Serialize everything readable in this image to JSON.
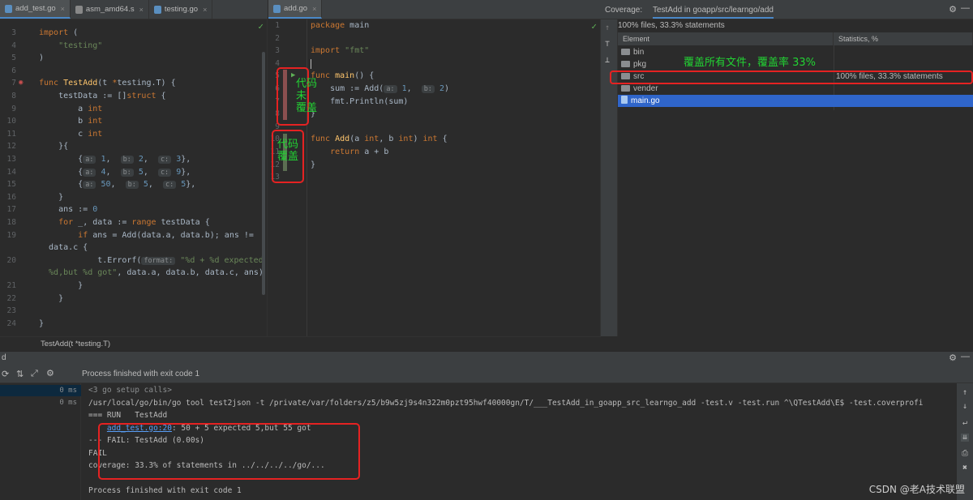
{
  "left_tabs": [
    {
      "label": "add_test.go",
      "active": true
    },
    {
      "label": "asm_amd64.s",
      "active": false
    },
    {
      "label": "testing.go",
      "active": false
    }
  ],
  "right_tabs": [
    {
      "label": "add.go",
      "active": true
    }
  ],
  "left_editor": {
    "lines": [
      {
        "n": "3",
        "html": "<span class='kw'>import</span> ("
      },
      {
        "n": "4",
        "html": "    <span class='str'>\"testing\"</span>"
      },
      {
        "n": "5",
        "html": ")"
      },
      {
        "n": "6",
        "html": ""
      },
      {
        "n": "7",
        "html": "<span class='kw'>func</span> <span class='fn'>TestAdd</span>(t <span class='kw'>*</span>testing.T) {"
      },
      {
        "n": "8",
        "html": "    testData := []<span class='kw'>struct</span> {"
      },
      {
        "n": "9",
        "html": "        a <span class='ty'>int</span>"
      },
      {
        "n": "10",
        "html": "        b <span class='ty'>int</span>"
      },
      {
        "n": "11",
        "html": "        c <span class='ty'>int</span>"
      },
      {
        "n": "12",
        "html": "    }{"
      },
      {
        "n": "13",
        "html": "        {<span class='hint'>a:</span> <span class='num'>1</span>,  <span class='hint'>b:</span> <span class='num'>2</span>,  <span class='hint'>c:</span> <span class='num'>3</span>},"
      },
      {
        "n": "14",
        "html": "        {<span class='hint'>a:</span> <span class='num'>4</span>,  <span class='hint'>b:</span> <span class='num'>5</span>,  <span class='hint'>c:</span> <span class='num'>9</span>},"
      },
      {
        "n": "15",
        "html": "        {<span class='hint'>a:</span> <span class='num'>50</span>,  <span class='hint'>b:</span> <span class='num'>5</span>,  <span class='hint'>c:</span> <span class='num'>5</span>},"
      },
      {
        "n": "16",
        "html": "    }"
      },
      {
        "n": "17",
        "html": "    ans := <span class='num'>0</span>"
      },
      {
        "n": "18",
        "html": "    <span class='kw'>for</span> _, data := <span class='kw'>range</span> testData {"
      },
      {
        "n": "19",
        "html": "        <span class='kw'>if</span> ans = Add(data.a, data.b); ans !="
      },
      {
        "n": "",
        "html": "  data.c {"
      },
      {
        "n": "20",
        "html": "            t.Errorf(<span class='hint'>format:</span> <span class='str'>\"%d + %d expected</span>"
      },
      {
        "n": "",
        "html": "<span class='str'>  %d,but %d got\"</span>, data.a, data.b, data.c, ans)"
      },
      {
        "n": "21",
        "html": "        }"
      },
      {
        "n": "22",
        "html": "    }"
      },
      {
        "n": "23",
        "html": ""
      },
      {
        "n": "24",
        "html": "}"
      }
    ]
  },
  "right_editor": {
    "lines": [
      {
        "n": "1",
        "html": "<span class='kw'>package</span> main"
      },
      {
        "n": "2",
        "html": ""
      },
      {
        "n": "3",
        "html": "<span class='kw'>import</span> <span class='str'>\"fmt\"</span>"
      },
      {
        "n": "4",
        "html": ""
      },
      {
        "n": "5",
        "html": "<span class='kw'>func</span> <span class='fn'>main</span>() {"
      },
      {
        "n": "6",
        "html": "    sum := Add(<span class='hint'>a:</span> <span class='num'>1</span>,  <span class='hint'>b:</span> <span class='num'>2</span>)"
      },
      {
        "n": "7",
        "html": "    fmt.Println(sum)"
      },
      {
        "n": "8",
        "html": "}"
      },
      {
        "n": "9",
        "html": ""
      },
      {
        "n": "10",
        "html": "<span class='kw'>func</span> <span class='fn'>Add</span>(a <span class='ty'>int</span>, b <span class='ty'>int</span>) <span class='ty'>int</span> {"
      },
      {
        "n": "11",
        "html": "    <span class='kw'>return</span> a + b"
      },
      {
        "n": "12",
        "html": "}"
      },
      {
        "n": "13",
        "html": ""
      }
    ]
  },
  "coverage": {
    "label": "Coverage:",
    "tab": "TestAdd in goapp/src/learngo/add",
    "summary": "100% files, 33.3% statements",
    "col_element": "Element",
    "col_stats": "Statistics, %",
    "rows": [
      {
        "name": "bin",
        "kind": "folder",
        "stats": ""
      },
      {
        "name": "pkg",
        "kind": "folder",
        "stats": ""
      },
      {
        "name": "src",
        "kind": "folder",
        "stats": "100% files, 33.3% statements"
      },
      {
        "name": "vender",
        "kind": "folder",
        "stats": ""
      },
      {
        "name": "main.go",
        "kind": "file",
        "stats": "",
        "selected": true
      }
    ]
  },
  "breadcrumb": "TestAdd(t *testing.T)",
  "run": {
    "panel_title": "d",
    "status": "Process finished with exit code 1",
    "tree": [
      {
        "time": "0 ms"
      },
      {
        "time": "0 ms"
      }
    ],
    "console": [
      {
        "html": "<span style='color:#8a8d8f'>&lt;3 go setup calls&gt;</span>"
      },
      {
        "html": "/usr/local/go/bin/go tool test2json -t /private/var/folders/z5/b9w5zj9s4n322m0pzt95hwf40000gn/T/___TestAdd_in_goapp_src_learngo_add -test.v -test.run ^\\QTestAdd\\E$ -test.coverprofi"
      },
      {
        "html": "=== RUN   TestAdd"
      },
      {
        "html": "    <span class='link'>add_test.go:20</span>: 50 + 5 expected 5,but 55 got"
      },
      {
        "html": "--- FAIL: TestAdd (0.00s)"
      },
      {
        "html": "FAIL"
      },
      {
        "html": "coverage: 33.3% of statements in ../../../../go/..."
      },
      {
        "html": ""
      },
      {
        "html": "Process finished with exit code 1"
      }
    ]
  },
  "annotations": {
    "uncovered": "代码\n未\n覆盖",
    "covered": "代码\n覆盖",
    "coverage_note": "覆盖所有文件，覆盖率 33%"
  },
  "watermark": "CSDN @老A技术联盟",
  "colors": {
    "covered_bar": "#5c6e52",
    "uncovered_bar": "#8b4f4f",
    "annotation": "#22d433",
    "highlight_box": "#e52222",
    "selection": "#2f65ca"
  }
}
